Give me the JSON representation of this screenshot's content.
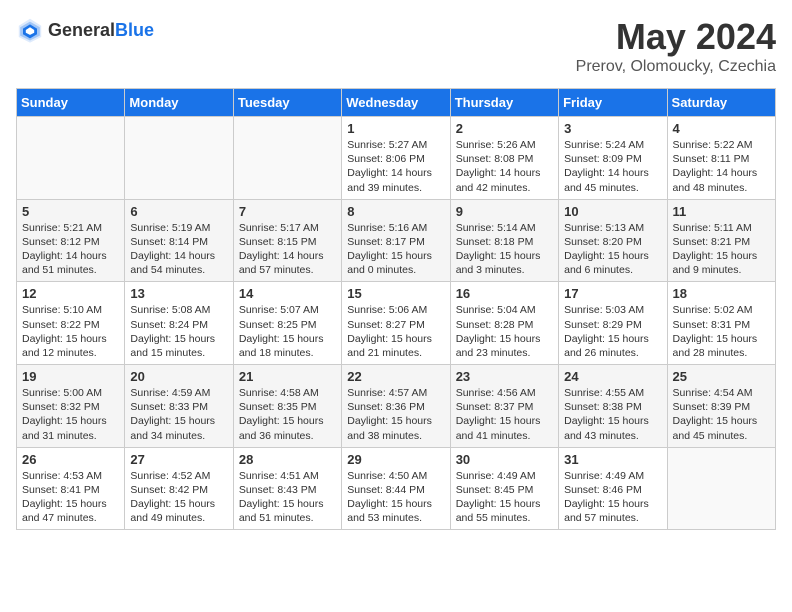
{
  "logo": {
    "text_general": "General",
    "text_blue": "Blue"
  },
  "title": {
    "month_year": "May 2024",
    "location": "Prerov, Olomoucky, Czechia"
  },
  "headers": [
    "Sunday",
    "Monday",
    "Tuesday",
    "Wednesday",
    "Thursday",
    "Friday",
    "Saturday"
  ],
  "weeks": [
    [
      {
        "day": "",
        "info": ""
      },
      {
        "day": "",
        "info": ""
      },
      {
        "day": "",
        "info": ""
      },
      {
        "day": "1",
        "info": "Sunrise: 5:27 AM\nSunset: 8:06 PM\nDaylight: 14 hours\nand 39 minutes."
      },
      {
        "day": "2",
        "info": "Sunrise: 5:26 AM\nSunset: 8:08 PM\nDaylight: 14 hours\nand 42 minutes."
      },
      {
        "day": "3",
        "info": "Sunrise: 5:24 AM\nSunset: 8:09 PM\nDaylight: 14 hours\nand 45 minutes."
      },
      {
        "day": "4",
        "info": "Sunrise: 5:22 AM\nSunset: 8:11 PM\nDaylight: 14 hours\nand 48 minutes."
      }
    ],
    [
      {
        "day": "5",
        "info": "Sunrise: 5:21 AM\nSunset: 8:12 PM\nDaylight: 14 hours\nand 51 minutes."
      },
      {
        "day": "6",
        "info": "Sunrise: 5:19 AM\nSunset: 8:14 PM\nDaylight: 14 hours\nand 54 minutes."
      },
      {
        "day": "7",
        "info": "Sunrise: 5:17 AM\nSunset: 8:15 PM\nDaylight: 14 hours\nand 57 minutes."
      },
      {
        "day": "8",
        "info": "Sunrise: 5:16 AM\nSunset: 8:17 PM\nDaylight: 15 hours\nand 0 minutes."
      },
      {
        "day": "9",
        "info": "Sunrise: 5:14 AM\nSunset: 8:18 PM\nDaylight: 15 hours\nand 3 minutes."
      },
      {
        "day": "10",
        "info": "Sunrise: 5:13 AM\nSunset: 8:20 PM\nDaylight: 15 hours\nand 6 minutes."
      },
      {
        "day": "11",
        "info": "Sunrise: 5:11 AM\nSunset: 8:21 PM\nDaylight: 15 hours\nand 9 minutes."
      }
    ],
    [
      {
        "day": "12",
        "info": "Sunrise: 5:10 AM\nSunset: 8:22 PM\nDaylight: 15 hours\nand 12 minutes."
      },
      {
        "day": "13",
        "info": "Sunrise: 5:08 AM\nSunset: 8:24 PM\nDaylight: 15 hours\nand 15 minutes."
      },
      {
        "day": "14",
        "info": "Sunrise: 5:07 AM\nSunset: 8:25 PM\nDaylight: 15 hours\nand 18 minutes."
      },
      {
        "day": "15",
        "info": "Sunrise: 5:06 AM\nSunset: 8:27 PM\nDaylight: 15 hours\nand 21 minutes."
      },
      {
        "day": "16",
        "info": "Sunrise: 5:04 AM\nSunset: 8:28 PM\nDaylight: 15 hours\nand 23 minutes."
      },
      {
        "day": "17",
        "info": "Sunrise: 5:03 AM\nSunset: 8:29 PM\nDaylight: 15 hours\nand 26 minutes."
      },
      {
        "day": "18",
        "info": "Sunrise: 5:02 AM\nSunset: 8:31 PM\nDaylight: 15 hours\nand 28 minutes."
      }
    ],
    [
      {
        "day": "19",
        "info": "Sunrise: 5:00 AM\nSunset: 8:32 PM\nDaylight: 15 hours\nand 31 minutes."
      },
      {
        "day": "20",
        "info": "Sunrise: 4:59 AM\nSunset: 8:33 PM\nDaylight: 15 hours\nand 34 minutes."
      },
      {
        "day": "21",
        "info": "Sunrise: 4:58 AM\nSunset: 8:35 PM\nDaylight: 15 hours\nand 36 minutes."
      },
      {
        "day": "22",
        "info": "Sunrise: 4:57 AM\nSunset: 8:36 PM\nDaylight: 15 hours\nand 38 minutes."
      },
      {
        "day": "23",
        "info": "Sunrise: 4:56 AM\nSunset: 8:37 PM\nDaylight: 15 hours\nand 41 minutes."
      },
      {
        "day": "24",
        "info": "Sunrise: 4:55 AM\nSunset: 8:38 PM\nDaylight: 15 hours\nand 43 minutes."
      },
      {
        "day": "25",
        "info": "Sunrise: 4:54 AM\nSunset: 8:39 PM\nDaylight: 15 hours\nand 45 minutes."
      }
    ],
    [
      {
        "day": "26",
        "info": "Sunrise: 4:53 AM\nSunset: 8:41 PM\nDaylight: 15 hours\nand 47 minutes."
      },
      {
        "day": "27",
        "info": "Sunrise: 4:52 AM\nSunset: 8:42 PM\nDaylight: 15 hours\nand 49 minutes."
      },
      {
        "day": "28",
        "info": "Sunrise: 4:51 AM\nSunset: 8:43 PM\nDaylight: 15 hours\nand 51 minutes."
      },
      {
        "day": "29",
        "info": "Sunrise: 4:50 AM\nSunset: 8:44 PM\nDaylight: 15 hours\nand 53 minutes."
      },
      {
        "day": "30",
        "info": "Sunrise: 4:49 AM\nSunset: 8:45 PM\nDaylight: 15 hours\nand 55 minutes."
      },
      {
        "day": "31",
        "info": "Sunrise: 4:49 AM\nSunset: 8:46 PM\nDaylight: 15 hours\nand 57 minutes."
      },
      {
        "day": "",
        "info": ""
      }
    ]
  ]
}
